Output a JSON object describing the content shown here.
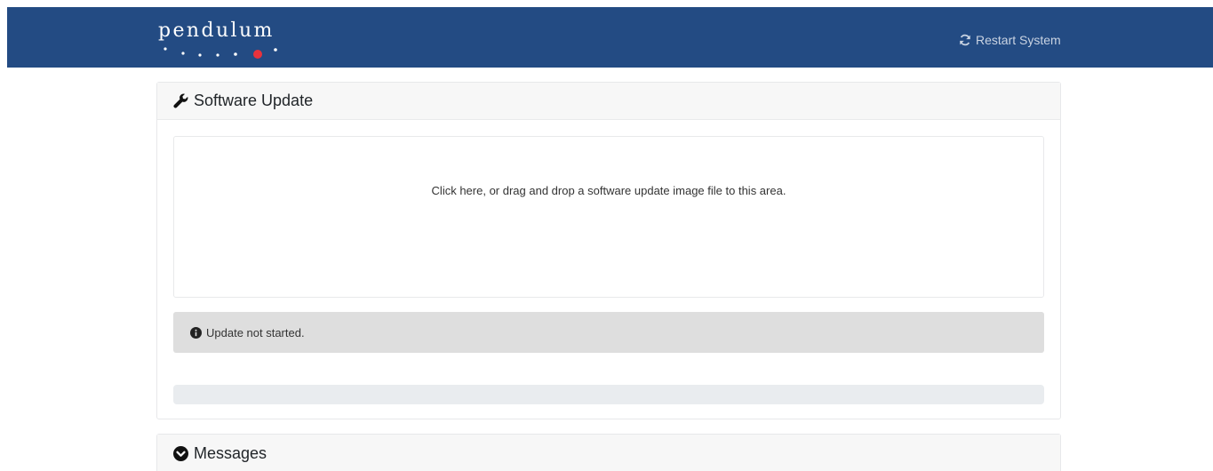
{
  "navbar": {
    "brand": "pendulum",
    "restart_label": "Restart System",
    "bg_color": "#234b83"
  },
  "update_card": {
    "title": "Software Update",
    "title_icon": "wrench-icon",
    "dropzone_text": "Click here, or drag and drop a software update image file to this area.",
    "status_icon": "info-circle-icon",
    "status_text": "Update not started.",
    "progress": 0
  },
  "messages_card": {
    "title": "Messages",
    "title_icon": "chevron-circle-down-icon"
  },
  "colors": {
    "brand_dot_accent": "#e8323c",
    "status_bg": "#dedede",
    "progress_track": "#e9ecef"
  }
}
